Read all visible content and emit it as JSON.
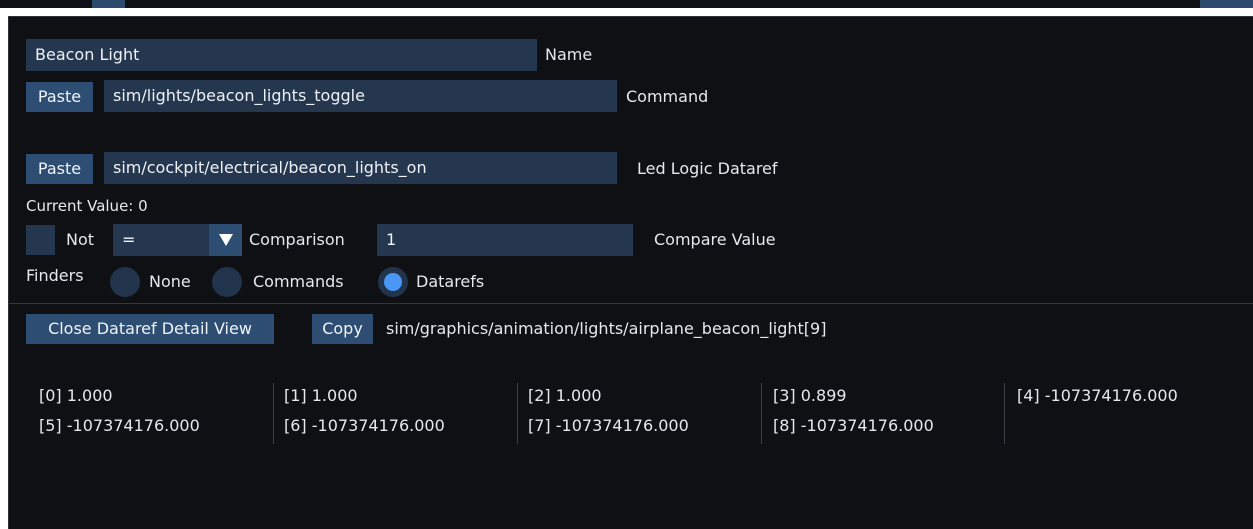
{
  "name_section": {
    "name_value": "Beacon Light",
    "name_label": "Name"
  },
  "command_section": {
    "paste_label": "Paste",
    "command_value": "sim/lights/beacon_lights_toggle",
    "command_label": "Command"
  },
  "led_section": {
    "paste_label": "Paste",
    "dataref_value": "sim/cockpit/electrical/beacon_lights_on",
    "dataref_label": "Led Logic Dataref",
    "current_value_text": "Current Value: 0"
  },
  "comparison_section": {
    "not_label": "Not",
    "operator_value": "=",
    "comparison_label": "Comparison",
    "compare_value": "1",
    "compare_value_label": "Compare Value"
  },
  "finders": {
    "label": "Finders",
    "options": [
      "None",
      "Commands",
      "Datarefs"
    ],
    "selected": "Datarefs"
  },
  "detail_view": {
    "close_label": "Close Dataref Detail View",
    "copy_label": "Copy",
    "dataref_path": "sim/graphics/animation/lights/airplane_beacon_light[9]",
    "values": [
      [
        "[0] 1.000",
        "[1] 1.000",
        "[2] 1.000",
        "[3] 0.899",
        "[4] -107374176.000"
      ],
      [
        "[5] -107374176.000",
        "[6] -107374176.000",
        "[7] -107374176.000",
        "[8] -107374176.000",
        ""
      ]
    ]
  },
  "colors": {
    "background": "#0e1014",
    "field": "#25374f",
    "button": "#2d4d72",
    "radio_selected": "#4a97f6"
  }
}
